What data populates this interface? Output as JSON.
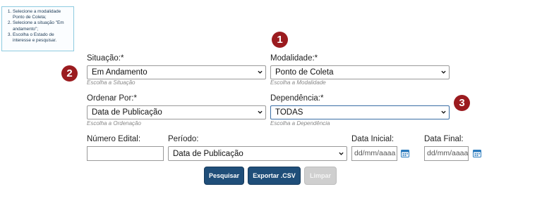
{
  "instructions": [
    "Selecione a modalidade Ponto de Coleta;",
    "Selecione a situação \"Em andamento\";",
    "Escolha o Estado de interesse e pesquisar."
  ],
  "markers": {
    "one": "1",
    "two": "2",
    "three": "3"
  },
  "situacao": {
    "label": "Situação:*",
    "value": "Em Andamento",
    "hint": "Escolha a Situação"
  },
  "modalidade": {
    "label": "Modalidade:*",
    "value": "Ponto de Coleta",
    "hint": "Escolha a Modalidade"
  },
  "ordenar": {
    "label": "Ordenar Por:*",
    "value": "Data de Publicação",
    "hint": "Escolha a Ordenação"
  },
  "dependencia": {
    "label": "Dependência:*",
    "value": "TODAS",
    "hint": "Escolha a Dependência"
  },
  "numero_edital": {
    "label": "Número Edital:",
    "value": ""
  },
  "periodo": {
    "label": "Período:",
    "value": "Data de Publicação"
  },
  "data_inicial": {
    "label": "Data Inicial:",
    "placeholder": "dd/mm/aaaa"
  },
  "data_final": {
    "label": "Data Final:",
    "placeholder": "dd/mm/aaaa"
  },
  "buttons": {
    "pesquisar": "Pesquisar",
    "exportar": "Exportar .CSV",
    "limpar": "Limpar"
  },
  "colors": {
    "marker": "#9b1b1f",
    "primary_button": "#1f4e79",
    "disabled_button": "#cfcfcf",
    "info_border": "#8ecbe0"
  }
}
